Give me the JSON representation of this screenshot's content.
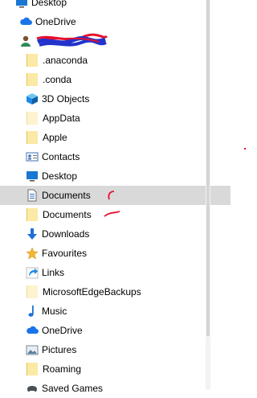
{
  "nav": {
    "items": [
      {
        "label": "Desktop",
        "icon": "desktop-icon"
      },
      {
        "label": "OneDrive",
        "icon": "onedrive-cloud-icon"
      },
      {
        "label": "",
        "icon": "user-icon"
      },
      {
        "label": ".anaconda",
        "icon": "folder-icon"
      },
      {
        "label": ".conda",
        "icon": "folder-icon"
      },
      {
        "label": "3D Objects",
        "icon": "3d-objects-icon"
      },
      {
        "label": "AppData",
        "icon": "folder-light-icon"
      },
      {
        "label": "Apple",
        "icon": "folder-icon"
      },
      {
        "label": "Contacts",
        "icon": "contacts-icon"
      },
      {
        "label": "Desktop",
        "icon": "desktop-icon"
      },
      {
        "label": "Documents",
        "icon": "documents-icon"
      },
      {
        "label": "Documents",
        "icon": "folder-icon"
      },
      {
        "label": "Downloads",
        "icon": "downloads-icon"
      },
      {
        "label": "Favourites",
        "icon": "star-icon"
      },
      {
        "label": "Links",
        "icon": "links-icon"
      },
      {
        "label": "MicrosoftEdgeBackups",
        "icon": "folder-light-icon"
      },
      {
        "label": "Music",
        "icon": "music-icon"
      },
      {
        "label": "OneDrive",
        "icon": "onedrive-cloud-icon"
      },
      {
        "label": "Pictures",
        "icon": "pictures-icon"
      },
      {
        "label": "Roaming",
        "icon": "folder-icon"
      },
      {
        "label": "Saved Games",
        "icon": "saved-games-icon"
      }
    ],
    "selected_index": 10
  },
  "colors": {
    "selection": "#d9d9d9",
    "folder": "#fbe9a6",
    "accent_blue": "#1e88e5",
    "annotation_red": "#e8102c",
    "redaction_blue": "#2233cc"
  }
}
